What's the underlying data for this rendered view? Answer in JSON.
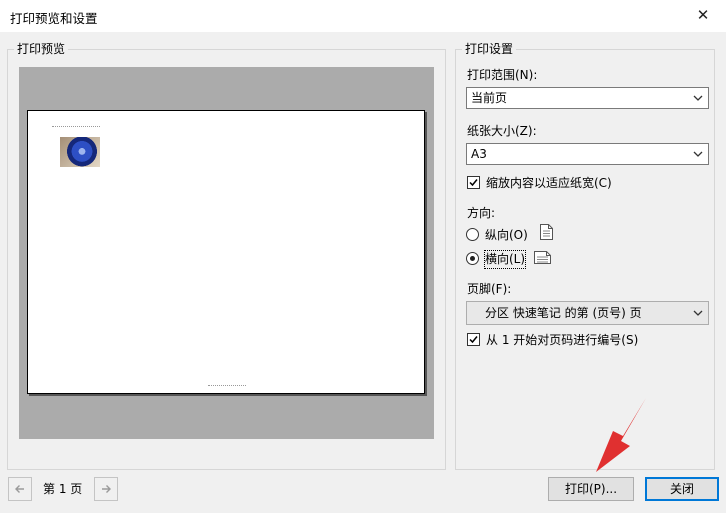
{
  "window": {
    "title": "打印预览和设置"
  },
  "preview": {
    "group_title": "打印预览"
  },
  "settings": {
    "group_title": "打印设置",
    "range": {
      "label": "打印范围(N):",
      "value": "当前页"
    },
    "paper_size": {
      "label": "纸张大小(Z):",
      "value": "A3"
    },
    "fit_width": {
      "label": "缩放内容以适应纸宽(C)",
      "checked": true
    },
    "orientation": {
      "label": "方向:",
      "portrait_label": "纵向(O)",
      "landscape_label": "横向(L)",
      "selected": "landscape"
    },
    "footer": {
      "label": "页脚(F):",
      "value": "分区 快速笔记 的第 (页号) 页"
    },
    "start_numbering": {
      "label": "从 1 开始对页码进行编号(S)",
      "checked": true
    }
  },
  "footer_bar": {
    "prev_icon": "arrow-left-icon",
    "next_icon": "arrow-right-icon",
    "page_text": "第 1 页",
    "print_label": "打印(P)...",
    "close_label": "关闭"
  },
  "colors": {
    "accent": "#0078d7",
    "preview_background": "#ababab",
    "annotation_arrow": "#e03030"
  }
}
